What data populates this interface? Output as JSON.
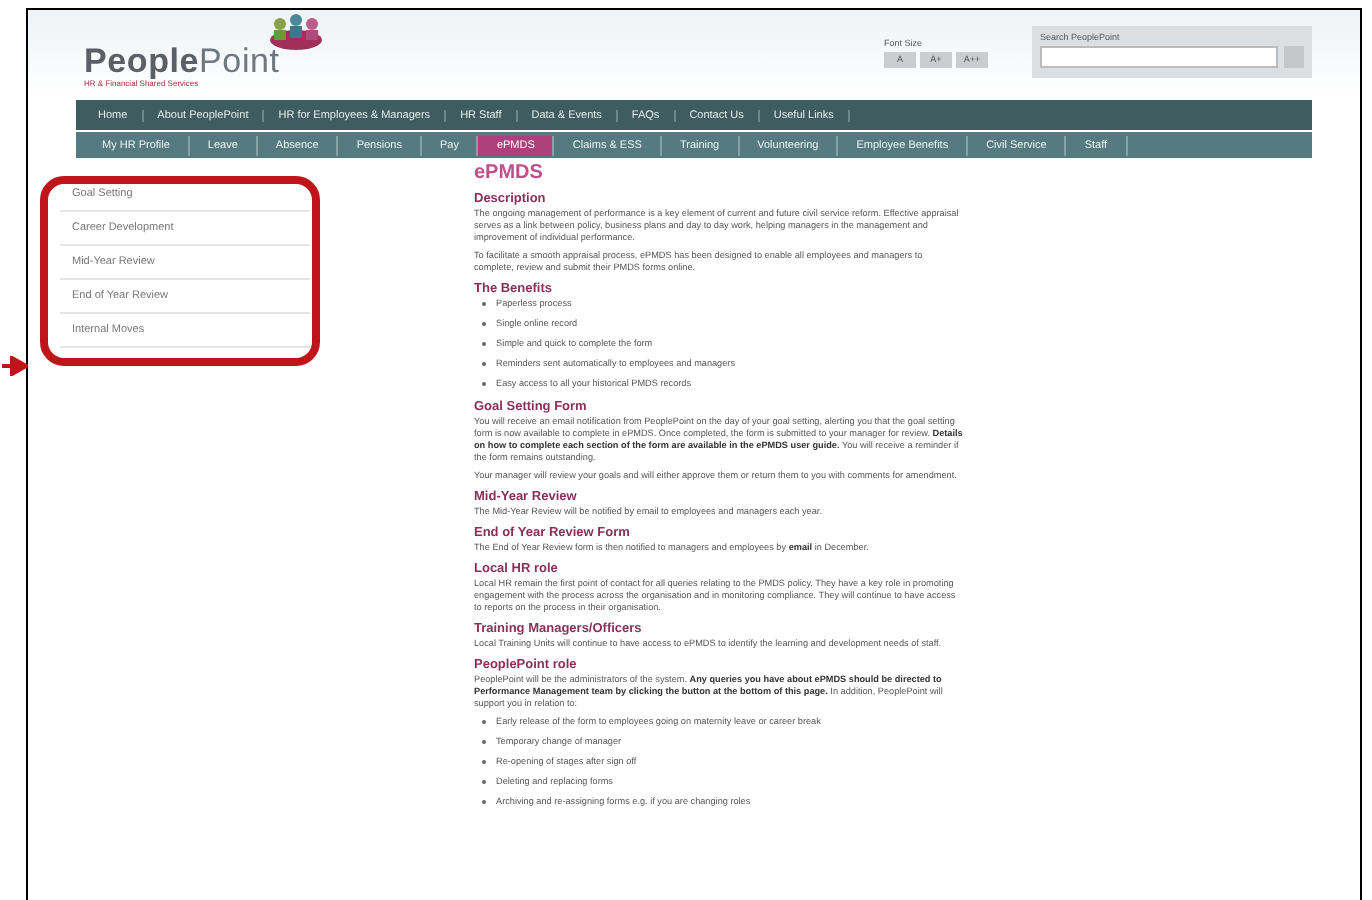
{
  "header": {
    "logo": {
      "name_a": "People",
      "name_b": "Point",
      "tagline": "HR & Financial Shared Services"
    },
    "font_size": {
      "label": "Font Size",
      "buttons": [
        "A",
        "A+",
        "A++"
      ]
    },
    "search": {
      "label": "Search PeoplePoint"
    }
  },
  "main_nav": [
    {
      "label": "Home",
      "selected": false
    },
    {
      "label": "About PeoplePoint",
      "selected": false
    },
    {
      "label": "HR for Employees & Managers",
      "selected": false
    },
    {
      "label": "HR Staff",
      "selected": false
    },
    {
      "label": "Data & Events",
      "selected": false
    },
    {
      "label": "FAQs",
      "selected": false
    },
    {
      "label": "Contact Us",
      "selected": false
    },
    {
      "label": "Useful Links",
      "selected": false
    }
  ],
  "sub_nav": [
    {
      "label": "My HR Profile",
      "selected": false
    },
    {
      "label": "Leave",
      "selected": false
    },
    {
      "label": "Absence",
      "selected": false
    },
    {
      "label": "Pensions",
      "selected": false
    },
    {
      "label": "Pay",
      "selected": false
    },
    {
      "label": "ePMDS",
      "selected": true
    },
    {
      "label": "Claims & ESS",
      "selected": false
    },
    {
      "label": "Training",
      "selected": false
    },
    {
      "label": "Volunteering",
      "selected": false
    },
    {
      "label": "Employee Benefits",
      "selected": false
    },
    {
      "label": "Civil Service",
      "selected": false
    },
    {
      "label": "Staff",
      "selected": false
    }
  ],
  "sidebar": [
    {
      "label": "Goal Setting"
    },
    {
      "label": "Career Development"
    },
    {
      "label": "Mid-Year Review"
    },
    {
      "label": "End of Year Review"
    },
    {
      "label": "Internal Moves"
    }
  ],
  "content": {
    "title": "ePMDS",
    "blocks": [
      {
        "kind": "heading",
        "text": "Description"
      },
      {
        "kind": "paragraph",
        "text": "The ongoing management of performance is a key element of current and future civil service reform. Effective appraisal serves as a link between policy, business plans and day to day work, helping managers in the management and improvement of individual performance."
      },
      {
        "kind": "paragraph",
        "text": "To facilitate a smooth appraisal process, ePMDS has been designed to enable all employees and managers to complete, review and submit their PMDS forms online."
      },
      {
        "kind": "heading",
        "text": "The Benefits"
      },
      {
        "kind": "bullets",
        "items": [
          "Paperless process",
          "Single online record",
          "Simple and quick to complete the form",
          "Reminders sent automatically to employees and managers",
          "Easy access to all your historical PMDS records"
        ]
      },
      {
        "kind": "heading",
        "text": "Goal Setting Form"
      },
      {
        "kind": "paragraph",
        "text": "You will receive an email notification from PeoplePoint on the day of your goal setting, alerting you that the goal setting form is now available to complete in ePMDS. Once completed, the form is submitted to your manager for review. **Details on how to complete each section of the form are available in the ePMDS user guide.** You will receive a reminder if the form remains outstanding."
      },
      {
        "kind": "paragraph",
        "text": "Your manager will review your goals and will either approve them or return them to you with comments for amendment."
      },
      {
        "kind": "heading",
        "text": "Mid-Year Review"
      },
      {
        "kind": "paragraph",
        "text": "The Mid-Year Review will be notified by email to employees and managers each year."
      },
      {
        "kind": "heading",
        "text": "End of Year Review Form"
      },
      {
        "kind": "paragraph",
        "text": "The End of Year Review form is then notified to managers and employees by **email** in December."
      },
      {
        "kind": "heading",
        "text": "Local HR role"
      },
      {
        "kind": "paragraph",
        "text": "Local HR remain the first point of contact for all queries relating to the PMDS policy. They have a key role in promoting engagement with the process across the organisation and in monitoring compliance. They will continue to have access to reports on the process in their organisation."
      },
      {
        "kind": "heading",
        "text": "Training Managers/Officers"
      },
      {
        "kind": "paragraph",
        "text": "Local Training Units will continue to have access to ePMDS to identify the learning and development needs of staff."
      },
      {
        "kind": "heading",
        "text": "PeoplePoint role"
      },
      {
        "kind": "paragraph",
        "text": "PeoplePoint will be the administrators of the system. **Any queries you have about ePMDS should be directed to Performance Management team by clicking the button at the bottom of this page.** In addition, PeoplePoint will support you in relation to:"
      },
      {
        "kind": "bullets",
        "items": [
          "Early release of the form to employees going on maternity leave or career break",
          "Temporary change of manager",
          "Re-opening of stages after sign off",
          "Deleting and replacing forms",
          "Archiving and re-assigning forms e.g. if you are changing roles"
        ]
      }
    ]
  }
}
